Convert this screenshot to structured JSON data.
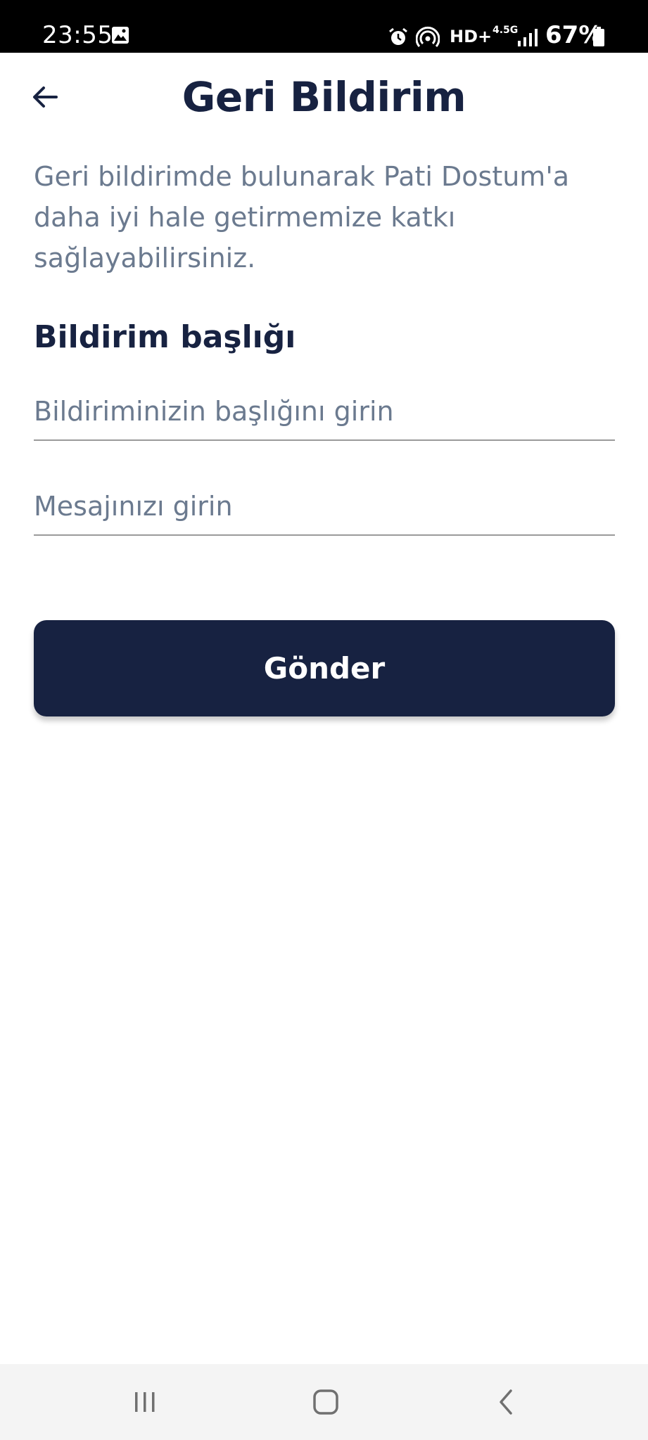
{
  "status_bar": {
    "time": "23:55",
    "network_badge": "HD+",
    "network_type": "4.5G",
    "battery": "67%",
    "icons": [
      "image-icon",
      "alarm-icon",
      "hotspot-icon",
      "signal-icon",
      "battery-icon"
    ]
  },
  "header": {
    "title": "Geri Bildirim",
    "back_icon": "arrow-left-icon"
  },
  "description": "Geri bildirimde bulunarak Pati Dostum'a daha iyi hale getirmemize katkı sağlayabilirsiniz.",
  "form": {
    "section_title": "Bildirim başlığı",
    "title_field": {
      "placeholder": "Bildiriminizin başlığını girin",
      "value": ""
    },
    "message_field": {
      "placeholder": "Mesajınızı girin",
      "value": ""
    },
    "submit_label": "Gönder"
  },
  "nav_bar": {
    "icons": [
      "recents-icon",
      "home-icon",
      "back-icon"
    ]
  },
  "colors": {
    "primary": "#172241",
    "muted_text": "#6b7a8f",
    "underline": "#9a9a9a",
    "nav_background": "#f4f4f4"
  }
}
